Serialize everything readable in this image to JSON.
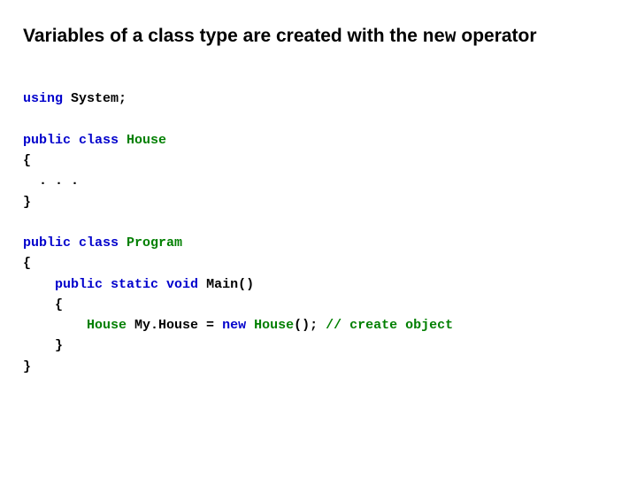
{
  "heading": {
    "prefix": "Variables of a class type are created with the ",
    "keyword": "new",
    "suffix": " operator"
  },
  "code": {
    "l01_using": "using",
    "l01_rest": " System;",
    "l03_pubclass": "public class",
    "l03_sp": " ",
    "l03_type": "House",
    "l04_brace_open": "{",
    "l05_dots": "  . . .",
    "l06_brace_close": "}",
    "l08_pubclass": "public class",
    "l08_sp": " ",
    "l08_type": "Program",
    "l09_brace_open": "{",
    "l10_indent": "    ",
    "l10_psv": "public static void",
    "l10_sp": " ",
    "l10_main": "Main()",
    "l11_brace_open": "    {",
    "l12_indent": "        ",
    "l12_type1": "House",
    "l12_sp1": " ",
    "l12_var_eq": "My.House = ",
    "l12_new": "new",
    "l12_sp2": " ",
    "l12_type2": "House",
    "l12_paren_semi": "(); ",
    "l12_comment": "// create object",
    "l13_brace_close": "    }",
    "l14_brace_close": "}"
  }
}
